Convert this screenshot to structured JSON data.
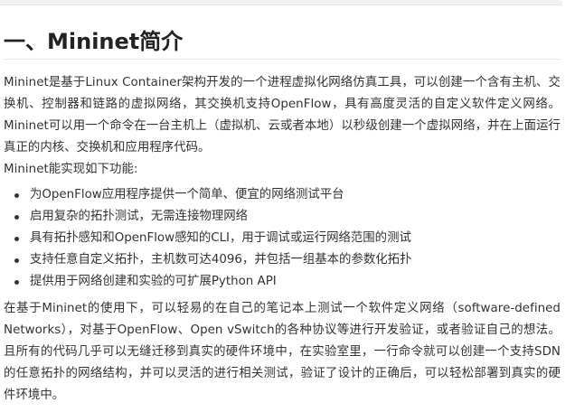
{
  "article": {
    "heading": "一、Mininet简介",
    "lead": "Mininet是基于Linux Container架构开发的一个进程虚拟化网络仿真工具，可以创建一个含有主机、交换机、控制器和链路的虚拟网络，其交换机支持OpenFlow，具有高度灵活的自定义软件定义网络。Mininet可以用一个命令在一台主机上（虚拟机、云或者本地）以秒级创建一个虚拟网络，并在上面运行真正的内核、交换机和应用程序代码。",
    "features_intro": "Mininet能实现如下功能:",
    "features": [
      "为OpenFlow应用程序提供一个简单、便宜的网络测试平台",
      "启用复杂的拓扑测试，无需连接物理网络",
      "具有拓扑感知和OpenFlow感知的CLI，用于调试或运行网络范围的测试",
      "支持任意自定义拓扑，主机数可达4096，并包括一组基本的参数化拓扑",
      "提供用于网络创建和实验的可扩展Python API"
    ],
    "closing": "在基于Mininet的使用下，可以轻易的在自己的笔记本上测试一个软件定义网络（software-defined Networks），对基于OpenFlow、Open vSwitch的各种协议等进行开发验证，或者验证自己的想法。且所有的代码几乎可以无缝迁移到真实的硬件环境中，在实验室里，一行命令就可以创建一个支持SDN的任意拓扑的网络结构，并可以灵活的进行相关测试，验证了设计的正确后，可以轻松部署到真实的硬件环境中。"
  }
}
